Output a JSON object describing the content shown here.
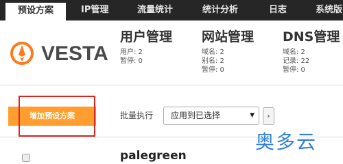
{
  "nav": {
    "tabs": [
      "预设方案",
      "IP管理",
      "流量统计",
      "统计分析",
      "日志",
      "系统版"
    ],
    "active_index": 0
  },
  "logo": {
    "text": "VESTA"
  },
  "stats": {
    "users": {
      "title": "用户管理",
      "lines": [
        "用户: 2",
        "暂停: 0"
      ]
    },
    "web": {
      "title": "网站管理",
      "lines": [
        "域名: 2",
        "别名: 2",
        "暂停: 0"
      ]
    },
    "dns": {
      "title": "DNS管理",
      "lines": [
        "域名: 2",
        "记录: 22",
        "暂停: 0"
      ]
    }
  },
  "toolbar": {
    "add_button": "增加预设方案",
    "bulk_label": "批量执行",
    "select_value": "应用到已选择",
    "select_arrow": "▼",
    "apply_symbol": "›"
  },
  "list": {
    "items": [
      {
        "name": "palegreen"
      }
    ]
  },
  "watermark": {
    "text": "奥多云"
  },
  "colors": {
    "nav_bg": "#262626",
    "accent": "#ff9d2e",
    "highlight_box": "#d9271c",
    "watermark": "#2f7fd9"
  }
}
